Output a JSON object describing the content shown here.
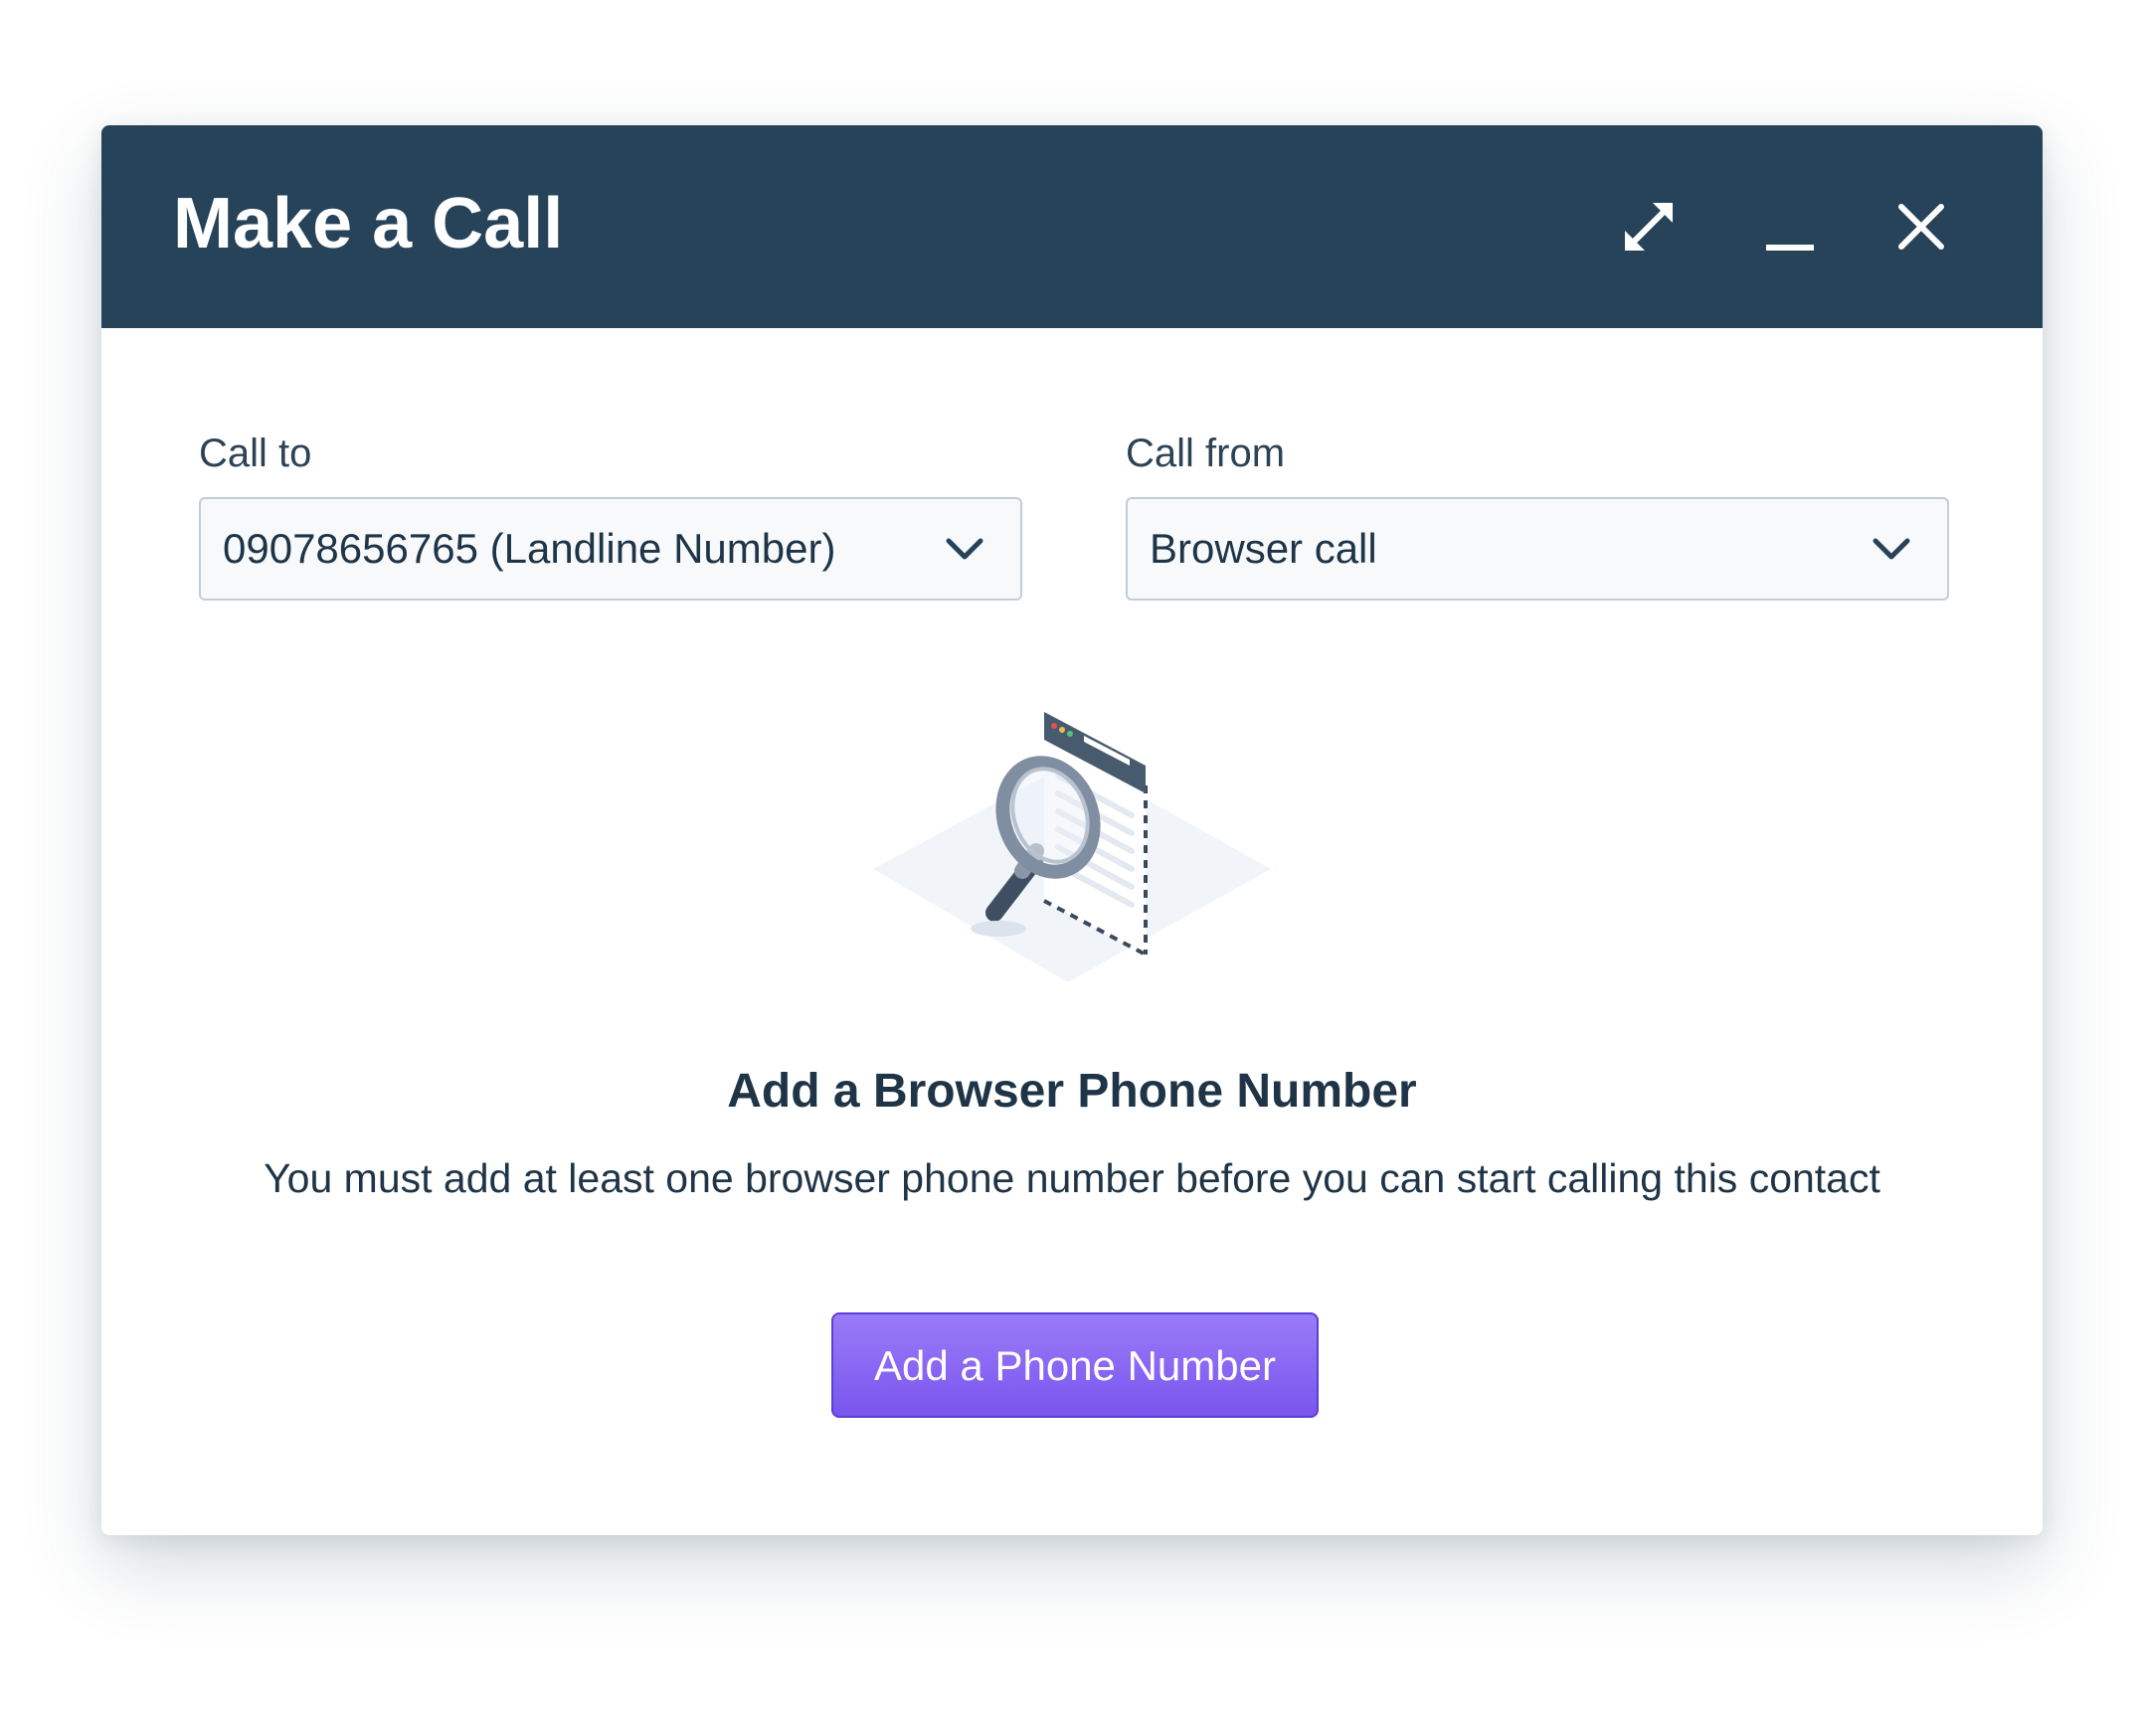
{
  "dialog": {
    "title": "Make a Call",
    "header_icons": [
      "expand-icon",
      "minimize-icon",
      "close-icon"
    ]
  },
  "call_to": {
    "label": "Call to",
    "selected": "09078656765 (Landline Number)"
  },
  "call_from": {
    "label": "Call from",
    "selected": "Browser call"
  },
  "empty_state": {
    "illustration": "magnifier-document-illustration",
    "title": "Add a Browser Phone Number",
    "description": "You must add at least one browser phone number before you can start calling this contact",
    "button_label": "Add a Phone Number"
  },
  "colors": {
    "header_bg": "#27435a",
    "accent": "#7a55ee",
    "text": "#1f3547"
  }
}
